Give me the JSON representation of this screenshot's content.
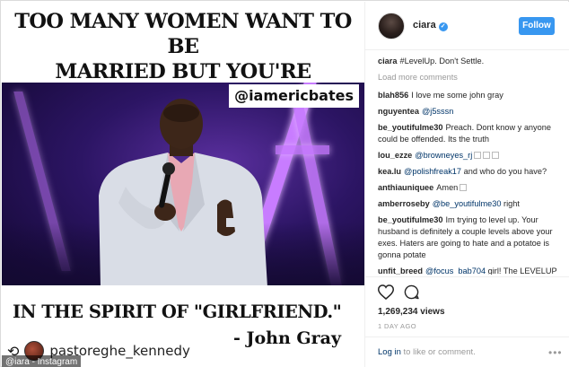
{
  "post": {
    "top_caption_line1": "TOO MANY WOMEN WANT TO BE",
    "top_caption_line2": "MARRIED BUT YOU'RE WALKING",
    "watermark": "@iamericbates",
    "bottom_caption": "IN THE SPIRIT OF \"GIRLFRIEND.\"",
    "attribution": "- John Gray",
    "regram_user": "pastoreghe_kennedy",
    "regram_icon": "⟲",
    "instagram_tag": "@iara - Instagram",
    "colors": {
      "stage_purple": "#2c1564",
      "neon": "#c87cff"
    }
  },
  "header": {
    "username": "ciara",
    "verified_glyph": "✓",
    "follow_label": "Follow"
  },
  "caption": {
    "user": "ciara",
    "text": "#LevelUp. Don't Settle."
  },
  "load_more": "Load more comments",
  "comments": [
    {
      "user": "blah856",
      "text": "I love me some john gray"
    },
    {
      "user": "nguyentea",
      "mention": "@j5sssn",
      "text": ""
    },
    {
      "user": "be_youtifulme30",
      "text": "Preach. Dont know y anyone could be offended. Its the truth"
    },
    {
      "user": "lou_ezze",
      "mention": "@browneyes_rj",
      "text": ""
    },
    {
      "user": "kea.lu",
      "mention": "@polishfreak17",
      "text": "and who do you have?"
    },
    {
      "user": "anthiauniquee",
      "text": "Amen"
    },
    {
      "user": "amberroseby",
      "mention": "@be_youtifulme30",
      "text": "right"
    },
    {
      "user": "be_youtifulme30",
      "text": "Im trying to level up. Your husband is definitely a couple levels above your exes. Haters are going to hate and a potatoe is gonna potate"
    },
    {
      "user": "unfit_breed",
      "mention": "@focus_bab704",
      "text": "girl! The LEVELUP"
    }
  ],
  "actions": {
    "views": "1,269,234 views",
    "ago": "1 DAY AGO",
    "login_link": "Log in",
    "login_rest": "to like or comment.",
    "more": "•••",
    "icons": [
      "heart-icon",
      "comment-icon",
      "more-options-icon"
    ]
  },
  "accent": "#3897f0"
}
